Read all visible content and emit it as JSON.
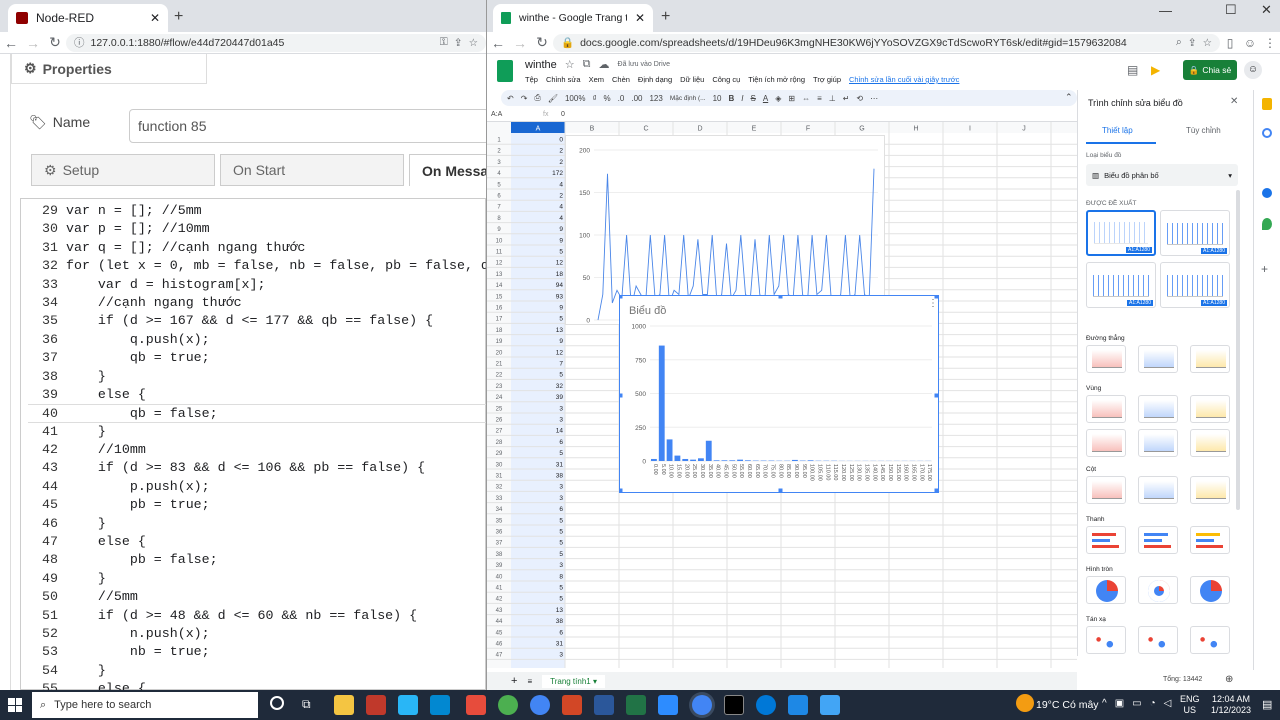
{
  "left_window": {
    "tab_title": "Node-RED",
    "url": "127.0.0.1:1880/#flow/e44d720447d01a45",
    "properties_title": "Properties",
    "name_label": "Name",
    "name_value": "function 85",
    "tabs": [
      "Setup",
      "On Start",
      "On Messa"
    ],
    "code_lines": [
      {
        "n": "29",
        "t": "var n = []; //5mm"
      },
      {
        "n": "30",
        "t": "var p = []; //10mm"
      },
      {
        "n": "31",
        "t": "var q = []; //cạnh ngang thước"
      },
      {
        "n": "32",
        "t": "for (let x = 0, mb = false, nb = false, pb = false, q"
      },
      {
        "n": "33",
        "t": "    var d = histogram[x];"
      },
      {
        "n": "34",
        "t": "    //cạnh ngang thước"
      },
      {
        "n": "35",
        "t": "    if (d >= 167 && d <= 177 && qb == false) {"
      },
      {
        "n": "36",
        "t": "        q.push(x);"
      },
      {
        "n": "37",
        "t": "        qb = true;"
      },
      {
        "n": "38",
        "t": "    }"
      },
      {
        "n": "39",
        "t": "    else {"
      },
      {
        "n": "40",
        "t": "        qb = false;"
      },
      {
        "n": "41",
        "t": "    }"
      },
      {
        "n": "42",
        "t": "    //10mm"
      },
      {
        "n": "43",
        "t": "    if (d >= 83 && d <= 106 && pb == false) {"
      },
      {
        "n": "44",
        "t": "        p.push(x);"
      },
      {
        "n": "45",
        "t": "        pb = true;"
      },
      {
        "n": "46",
        "t": "    }"
      },
      {
        "n": "47",
        "t": "    else {"
      },
      {
        "n": "48",
        "t": "        pb = false;"
      },
      {
        "n": "49",
        "t": "    }"
      },
      {
        "n": "50",
        "t": "    //5mm"
      },
      {
        "n": "51",
        "t": "    if (d >= 48 && d <= 60 && nb == false) {"
      },
      {
        "n": "52",
        "t": "        n.push(x);"
      },
      {
        "n": "53",
        "t": "        nb = true;"
      },
      {
        "n": "54",
        "t": "    }"
      },
      {
        "n": "55",
        "t": "    else {"
      }
    ]
  },
  "right_window": {
    "tab_title": "winthe - Google Trang tính",
    "url": "docs.google.com/spreadsheets/d/19HDeu96K3mgNHE30KW6jYYoSOVZGX9cTdScwoRYT6sk/edit#gid=1579632084",
    "doc_title": "winthe",
    "drive_status": "Đã lưu vào Drive",
    "menu": [
      "Tệp",
      "Chỉnh sửa",
      "Xem",
      "Chèn",
      "Định dạng",
      "Dữ liệu",
      "Công cụ",
      "Tiện ích mở rộng",
      "Trợ giúp"
    ],
    "last_edit": "Chỉnh sửa lần cuối vài giây trước",
    "share_label": "Chia sẻ",
    "toolbar_zoom": "100%",
    "toolbar_font": "Mặc định (...",
    "toolbar_size": "10",
    "toolbar_num": "123",
    "cell_ref": "A:A",
    "formula_value": "0",
    "columns": [
      "A",
      "B",
      "C",
      "D",
      "E",
      "F",
      "G",
      "H",
      "I",
      "J"
    ],
    "row_numbers": [
      "1",
      "2",
      "3",
      "4",
      "5",
      "6",
      "7",
      "8",
      "9",
      "10",
      "11",
      "12",
      "13",
      "14",
      "15",
      "16",
      "17",
      "18",
      "19",
      "20",
      "21",
      "22",
      "23",
      "24",
      "25",
      "26",
      "27",
      "28",
      "29",
      "30",
      "31",
      "32",
      "33",
      "34",
      "35",
      "36",
      "37",
      "38",
      "39",
      "40",
      "41",
      "42",
      "43",
      "44",
      "45",
      "46",
      "47"
    ],
    "col_a_values": [
      "0",
      "2",
      "2",
      "172",
      "4",
      "2",
      "4",
      "4",
      "9",
      "9",
      "5",
      "12",
      "18",
      "94",
      "93",
      "9",
      "5",
      "13",
      "9",
      "12",
      "7",
      "5",
      "32",
      "39",
      "3",
      "3",
      "14",
      "6",
      "5",
      "31",
      "38",
      "3",
      "3",
      "6",
      "5",
      "5",
      "5",
      "5",
      "3",
      "8",
      "5",
      "5",
      "13",
      "38",
      "6",
      "31",
      "3"
    ],
    "sheet_tab": "Trang tính1",
    "sum_label": "Tổng: 13442",
    "chart_title": "Biểu đồ",
    "sidebar": {
      "title": "Trình chỉnh sửa biểu đồ",
      "tab_setup": "Thiết lập",
      "tab_custom": "Tùy chỉnh",
      "chart_type_label": "Loại biểu đồ",
      "chart_type_value": "Biểu đồ phân bố",
      "suggested": "ĐƯỢC ĐỀ XUẤT",
      "thumb_label": "A1:A1280",
      "cat_line": "Đường thẳng",
      "cat_area": "Vùng",
      "cat_column": "Cột",
      "cat_bar": "Thanh",
      "cat_pie": "Hình tròn",
      "cat_scatter": "Tán xạ"
    }
  },
  "chart_data": [
    {
      "type": "line",
      "title": "",
      "ylim": [
        0,
        200
      ],
      "y_ticks": [
        "200",
        "150",
        "100",
        "50",
        "0"
      ],
      "values": [
        0,
        30,
        172,
        20,
        35,
        25,
        100,
        15,
        40,
        30,
        20,
        100,
        25,
        30,
        100,
        20,
        35,
        30,
        100,
        25,
        40,
        95,
        30,
        30,
        100,
        20,
        30,
        90,
        25,
        35,
        100,
        30,
        25,
        95,
        30,
        20,
        100,
        30,
        40,
        100,
        30,
        25,
        100,
        30,
        20,
        100,
        30,
        35,
        100,
        25,
        20,
        30,
        100,
        25,
        30,
        100,
        30,
        25,
        178
      ]
    },
    {
      "type": "bar",
      "title": "Biểu đồ",
      "ylim": [
        0,
        1000
      ],
      "y_ticks": [
        "1000",
        "750",
        "500",
        "250",
        "0"
      ],
      "categories": [
        "0.00",
        "5.00",
        "10.00",
        "15.00",
        "20.00",
        "25.00",
        "30.00",
        "35.00",
        "40.00",
        "45.00",
        "50.00",
        "55.00",
        "60.00",
        "65.00",
        "70.00",
        "75.00",
        "80.00",
        "85.00",
        "90.00",
        "95.00",
        "100.00",
        "105.00",
        "110.00",
        "115.00",
        "120.00",
        "125.00",
        "130.00",
        "135.00",
        "140.00",
        "145.00",
        "150.00",
        "155.00",
        "160.00",
        "165.00",
        "170.00",
        "175.00"
      ],
      "values": [
        15,
        855,
        160,
        40,
        15,
        10,
        20,
        150,
        5,
        5,
        5,
        10,
        5,
        3,
        3,
        3,
        2,
        2,
        8,
        3,
        5,
        2,
        2,
        2,
        1,
        1,
        1,
        1,
        1,
        1,
        1,
        1,
        1,
        1,
        1,
        1
      ]
    }
  ],
  "taskbar": {
    "search_placeholder": "Type here to search",
    "weather": "19°C  Có mây",
    "lang": "ENG",
    "lang2": "US",
    "time": "12:04 AM",
    "date": "1/12/2023"
  }
}
